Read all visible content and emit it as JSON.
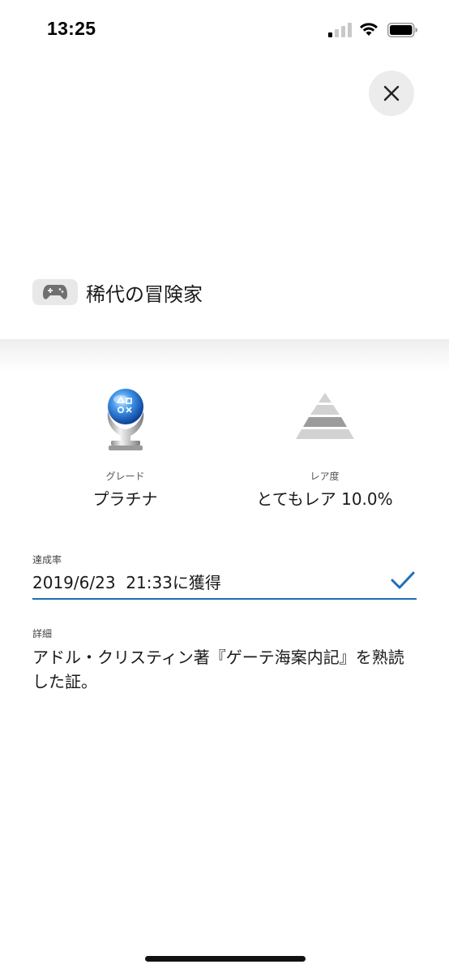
{
  "status_bar": {
    "time": "13:25"
  },
  "trophy": {
    "title": "稀代の冒険家",
    "grade_caption": "グレード",
    "grade_value": "プラチナ",
    "rarity_caption": "レア度",
    "rarity_value": "とてもレア 10.0%"
  },
  "achievement": {
    "label": "達成率",
    "value": "2019/6/23  21:33に獲得"
  },
  "detail": {
    "label": "詳細",
    "text": "アドル・クリスティン著『ゲーテ海案内記』を熟読した証。"
  },
  "icons": {
    "close": "close-icon",
    "platform": "gamepad-icon",
    "grade": "platinum-trophy-icon",
    "rarity": "pyramid-icon",
    "check": "checkmark-icon"
  },
  "colors": {
    "accent": "#1e6fb8",
    "badge_bg": "#e8e8e8",
    "close_bg": "#ececec"
  }
}
